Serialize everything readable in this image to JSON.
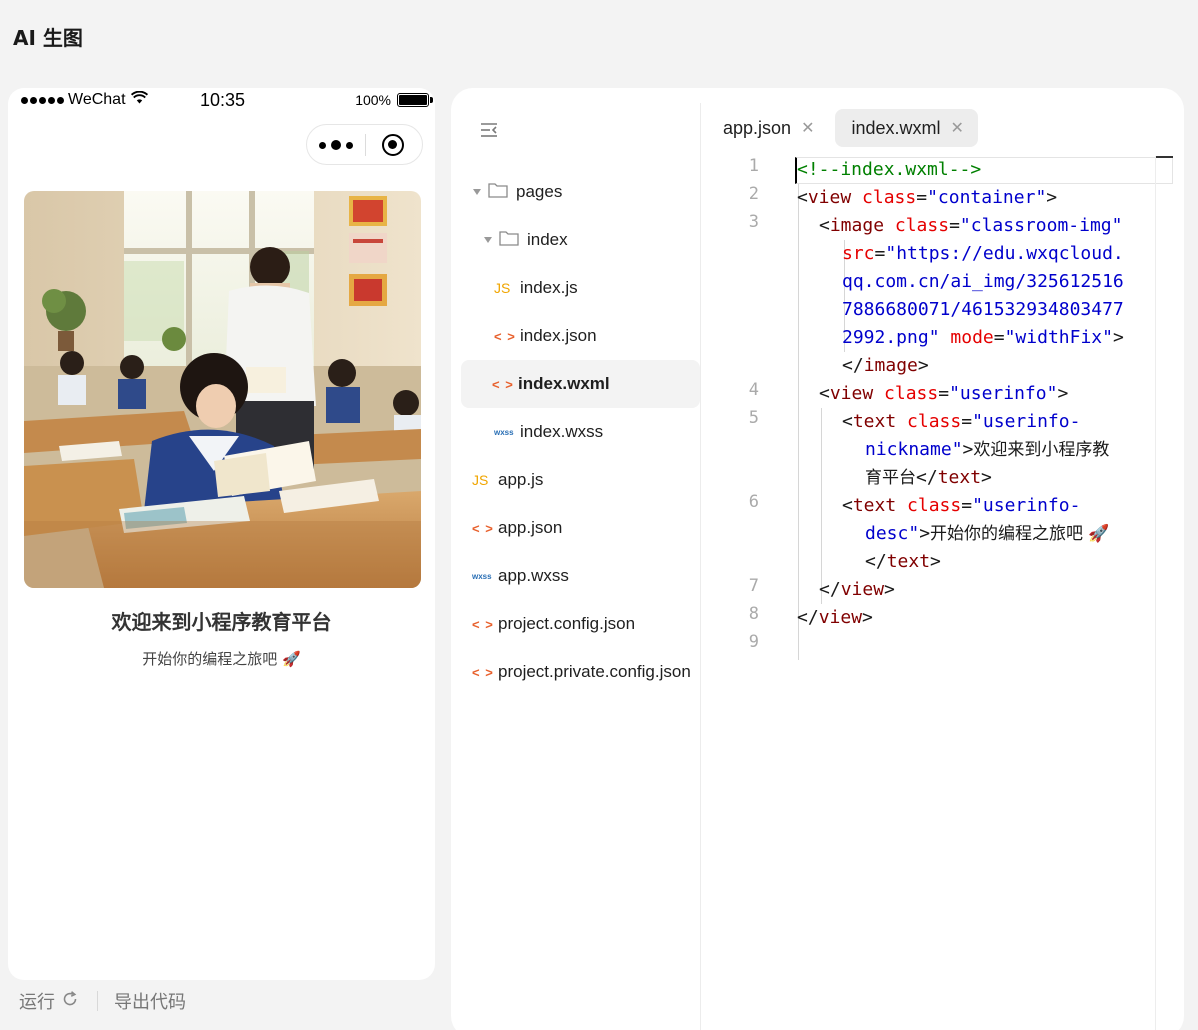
{
  "app": {
    "title": "AI 生图"
  },
  "phone": {
    "status": {
      "carrier": "WeChat",
      "time": "10:35",
      "battery": "100%"
    },
    "welcome": "欢迎来到小程序教育平台",
    "desc": "开始你的编程之旅吧 🚀"
  },
  "actions": {
    "run": "运行",
    "export": "导出代码"
  },
  "tree": {
    "items": [
      {
        "label": "pages",
        "type": "folder"
      },
      {
        "label": "index",
        "type": "folder"
      },
      {
        "label": "index.js",
        "type": "js",
        "icon_text": "JS"
      },
      {
        "label": "index.json",
        "type": "code",
        "icon_text": "< >"
      },
      {
        "label": "index.wxml",
        "type": "code",
        "icon_text": "< >",
        "active": true
      },
      {
        "label": "index.wxss",
        "type": "wxss",
        "icon_text": "wxss"
      },
      {
        "label": "app.js",
        "type": "js",
        "icon_text": "JS"
      },
      {
        "label": "app.json",
        "type": "code",
        "icon_text": "< >"
      },
      {
        "label": "app.wxss",
        "type": "wxss",
        "icon_text": "wxss"
      },
      {
        "label": "project.config.json",
        "type": "code",
        "icon_text": "< >"
      },
      {
        "label": "project.private.config.json",
        "type": "code",
        "icon_text": "< >"
      }
    ]
  },
  "tabs": [
    {
      "label": "app.json",
      "close": "✕",
      "active": false
    },
    {
      "label": "index.wxml",
      "close": "✕",
      "active": true
    }
  ],
  "code": {
    "line_numbers": [
      "1",
      "2",
      "3",
      "4",
      "5",
      "6",
      "7",
      "8",
      "9"
    ],
    "lines": [
      [
        {
          "c": "cmt",
          "t": "<!--index.wxml-->"
        }
      ],
      [
        {
          "c": "txt",
          "t": "<"
        },
        {
          "c": "tag",
          "t": "view"
        },
        {
          "c": "txt",
          "t": " "
        },
        {
          "c": "attr",
          "t": "class"
        },
        {
          "c": "txt",
          "t": "="
        },
        {
          "c": "val",
          "t": "\"container\""
        },
        {
          "c": "txt",
          "t": ">"
        }
      ],
      [
        {
          "c": "txt",
          "t": "<"
        },
        {
          "c": "tag",
          "t": "image"
        },
        {
          "c": "txt",
          "t": " "
        },
        {
          "c": "attr",
          "t": "class"
        },
        {
          "c": "txt",
          "t": "="
        },
        {
          "c": "val",
          "t": "\"classroom-img\""
        }
      ],
      [
        {
          "c": "attr",
          "t": "src"
        },
        {
          "c": "txt",
          "t": "="
        },
        {
          "c": "val",
          "t": "\"https://edu.wxqcloud."
        }
      ],
      [
        {
          "c": "val",
          "t": "qq.com.cn/ai_img/325612516"
        }
      ],
      [
        {
          "c": "val",
          "t": "7886680071/461532934803477"
        }
      ],
      [
        {
          "c": "val",
          "t": "2992.png\""
        },
        {
          "c": "txt",
          "t": " "
        },
        {
          "c": "attr",
          "t": "mode"
        },
        {
          "c": "txt",
          "t": "="
        },
        {
          "c": "val",
          "t": "\"widthFix\""
        },
        {
          "c": "txt",
          "t": ">"
        }
      ],
      [
        {
          "c": "txt",
          "t": "</"
        },
        {
          "c": "tag",
          "t": "image"
        },
        {
          "c": "txt",
          "t": ">"
        }
      ],
      [
        {
          "c": "txt",
          "t": "<"
        },
        {
          "c": "tag",
          "t": "view"
        },
        {
          "c": "txt",
          "t": " "
        },
        {
          "c": "attr",
          "t": "class"
        },
        {
          "c": "txt",
          "t": "="
        },
        {
          "c": "val",
          "t": "\"userinfo\""
        },
        {
          "c": "txt",
          "t": ">"
        }
      ],
      [
        {
          "c": "txt",
          "t": "<"
        },
        {
          "c": "tag",
          "t": "text"
        },
        {
          "c": "txt",
          "t": " "
        },
        {
          "c": "attr",
          "t": "class"
        },
        {
          "c": "txt",
          "t": "="
        },
        {
          "c": "val",
          "t": "\"userinfo-"
        }
      ],
      [
        {
          "c": "val",
          "t": "nickname\""
        },
        {
          "c": "txt",
          "t": ">"
        },
        {
          "c": "txt txt-cn",
          "t": "欢迎来到小程序教"
        }
      ],
      [
        {
          "c": "txt txt-cn",
          "t": "育平台"
        },
        {
          "c": "txt",
          "t": "</"
        },
        {
          "c": "tag",
          "t": "text"
        },
        {
          "c": "txt",
          "t": ">"
        }
      ],
      [
        {
          "c": "txt",
          "t": "<"
        },
        {
          "c": "tag",
          "t": "text"
        },
        {
          "c": "txt",
          "t": " "
        },
        {
          "c": "attr",
          "t": "class"
        },
        {
          "c": "txt",
          "t": "="
        },
        {
          "c": "val",
          "t": "\"userinfo-"
        }
      ],
      [
        {
          "c": "val",
          "t": "desc\""
        },
        {
          "c": "txt",
          "t": ">"
        },
        {
          "c": "txt txt-cn",
          "t": "开始你的编程之旅吧 🚀"
        }
      ],
      [
        {
          "c": "txt",
          "t": "</"
        },
        {
          "c": "tag",
          "t": "text"
        },
        {
          "c": "txt",
          "t": ">"
        }
      ],
      [
        {
          "c": "txt",
          "t": "</"
        },
        {
          "c": "tag",
          "t": "view"
        },
        {
          "c": "txt",
          "t": ">"
        }
      ],
      [
        {
          "c": "txt",
          "t": "</"
        },
        {
          "c": "tag",
          "t": "view"
        },
        {
          "c": "txt",
          "t": ">"
        }
      ]
    ]
  }
}
